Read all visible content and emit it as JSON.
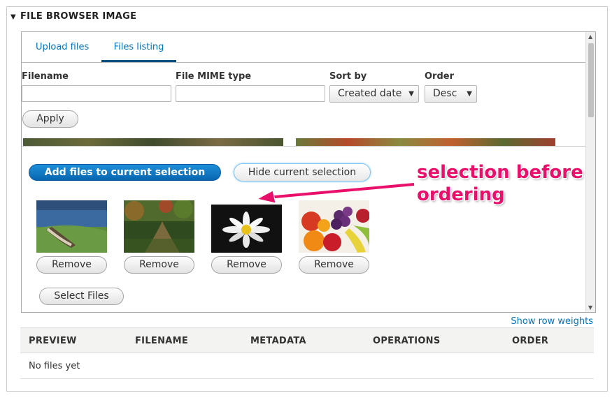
{
  "fieldset": {
    "title": "FILE BROWSER IMAGE",
    "collapse_icon": "triangle-down-icon"
  },
  "tabs": [
    {
      "label": "Upload files",
      "active": false
    },
    {
      "label": "Files listing",
      "active": true
    }
  ],
  "filters": {
    "filename_label": "Filename",
    "filename_value": "",
    "mime_label": "File MIME type",
    "mime_value": "",
    "sort_label": "Sort by",
    "sort_value": "Created date",
    "order_label": "Order",
    "order_value": "Desc",
    "apply_label": "Apply"
  },
  "selection": {
    "add_label": "Add files to current selection",
    "hide_label": "Hide current selection",
    "items": [
      {
        "image": "rowboat-lake-image",
        "remove_label": "Remove"
      },
      {
        "image": "forest-path-image",
        "remove_label": "Remove"
      },
      {
        "image": "daisy-flower-image",
        "remove_label": "Remove"
      },
      {
        "image": "fruit-basket-image",
        "remove_label": "Remove"
      }
    ],
    "select_files_label": "Select Files"
  },
  "annotation": {
    "line1": "selection before",
    "line2": "ordering",
    "color": "#e8106a"
  },
  "table": {
    "show_row_weights": "Show row weights",
    "columns": [
      "PREVIEW",
      "FILENAME",
      "METADATA",
      "OPERATIONS",
      "ORDER"
    ],
    "empty_text": "No files yet"
  },
  "colors": {
    "link": "#0074bd",
    "primary": "#0766b0",
    "active_tab": "#004f80"
  }
}
